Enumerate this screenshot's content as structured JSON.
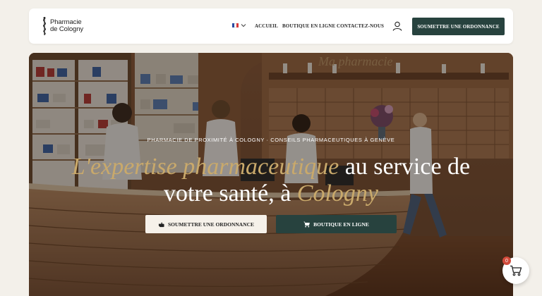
{
  "header": {
    "logo_line1": "Pharmacie",
    "logo_line2": "de Cologny",
    "language_icon": "french-flag-icon",
    "nav": {
      "accueil": "ACCUEIL",
      "boutique": "BOUTIQUE EN LIGNE",
      "contact": "CONTACTEZ-NOUS"
    },
    "account_icon": "user-icon",
    "cta_label": "SOUMETTRE UNE ORDONNANCE"
  },
  "hero": {
    "eyebrow": "PHARMACIE DE PROXIMITÉ À COLOGNY · CONSEILS PHARMACEUTIQUES À GENÈVE",
    "headline_gold_1": "L'expertise pharmaceutique",
    "headline_white_1": " au service de",
    "headline_white_2": "votre santé, à ",
    "headline_gold_2": "Cologny",
    "background_sign": "Ma pharmacie",
    "primary_button": "SOUMETTRE UNE ORDONNANCE",
    "secondary_button": "BOUTIQUE EN LIGNE"
  },
  "cart": {
    "count": "0"
  },
  "colors": {
    "brand_green": "#27423e",
    "gold": "#c9a96b",
    "badge_red": "#d24b3b",
    "page_bg": "#f3f0ea"
  }
}
